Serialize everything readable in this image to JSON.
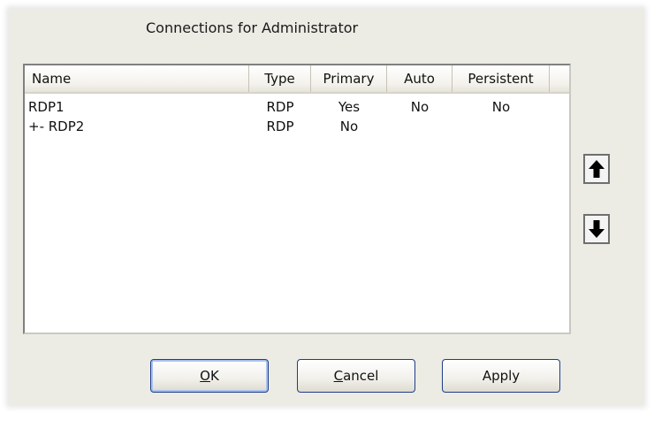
{
  "dialog": {
    "title": "Connections for Administrator"
  },
  "list": {
    "columns": [
      "Name",
      "Type",
      "Primary",
      "Auto",
      "Persistent"
    ],
    "rows": [
      {
        "name": "RDP1",
        "type": "RDP",
        "primary": "Yes",
        "auto": "No",
        "persistent": "No"
      },
      {
        "name": "+- RDP2",
        "type": "RDP",
        "primary": "No",
        "auto": "",
        "persistent": ""
      }
    ]
  },
  "side_buttons": {
    "up_icon": "arrow-up-icon",
    "down_icon": "arrow-down-icon"
  },
  "buttons": {
    "ok_mnemonic": "O",
    "ok_rest": "K",
    "cancel_mnemonic": "C",
    "cancel_rest": "ancel",
    "apply": "Apply"
  }
}
